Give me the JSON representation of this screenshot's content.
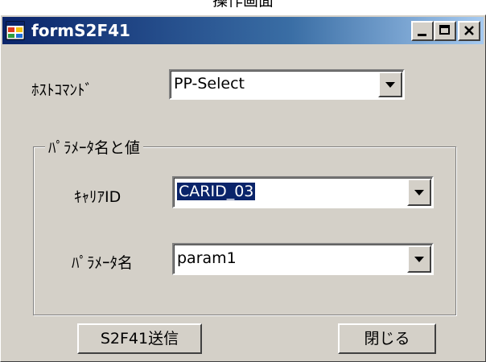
{
  "page_caption": "操作画面",
  "window": {
    "title": "formS2F41"
  },
  "host_command": {
    "label": "ﾎｽﾄｺﾏﾝﾄﾞ",
    "value": "PP-Select"
  },
  "parameters": {
    "group_title": "ﾊﾟﾗﾒｰﾀ名と値",
    "carrier_id": {
      "label": "ｷｬﾘｱID",
      "value": "CARID_03"
    },
    "param_name": {
      "label": "ﾊﾟﾗﾒｰﾀ名",
      "value": "param1"
    }
  },
  "buttons": {
    "send": "S2F41送信",
    "close": "閉じる"
  },
  "colors": {
    "titlebar_start": "#0a246a",
    "titlebar_end": "#a6caf0",
    "window_face": "#d4d0c8",
    "selection": "#0a246a"
  }
}
